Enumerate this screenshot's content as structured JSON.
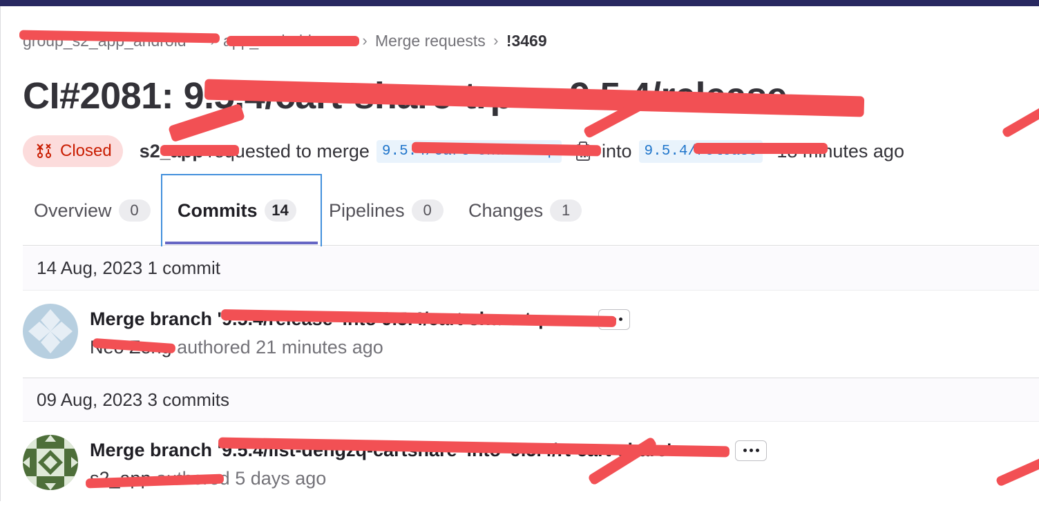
{
  "breadcrumb": {
    "group": "group_s2_app_android",
    "project": "app_android",
    "section": "Merge requests",
    "current": "!3469"
  },
  "title": "CI#2081: 9.5.4/cart-share-trp → 9.5.4/release",
  "status": {
    "badge": "Closed",
    "author": "s2_app",
    "requested_text": "requested to merge",
    "source_branch": "9.5.4/cart-share-trp",
    "into_text": "into",
    "target_branch": "9.5.4/release",
    "time": "18 minutes ago"
  },
  "tabs": [
    {
      "label": "Overview",
      "count": "0"
    },
    {
      "label": "Commits",
      "count": "14",
      "active": true
    },
    {
      "label": "Pipelines",
      "count": "0"
    },
    {
      "label": "Changes",
      "count": "1"
    }
  ],
  "groups": [
    {
      "date": "14 Aug, 2023 1 commit",
      "commit": {
        "title": "Merge branch '9.5.4/release' into 9.5.4/cart-share-trp",
        "author": "Neo Zeng",
        "authored": "authored 21 minutes ago"
      }
    },
    {
      "date": "09 Aug, 2023 3 commits",
      "commit": {
        "title": "Merge branch '9.5.4/list-dengzq-cartshare' into '9.5.4/rt-cart-share'",
        "author": "s2_app",
        "authored": "authored 5 days ago"
      }
    }
  ],
  "colors": {
    "closed_badge_bg": "#fcdcdc",
    "closed_badge_text": "#c91c00",
    "active_tab_underline": "#6666c4",
    "focus_outline": "#428fdc",
    "redaction": "#f25054"
  }
}
